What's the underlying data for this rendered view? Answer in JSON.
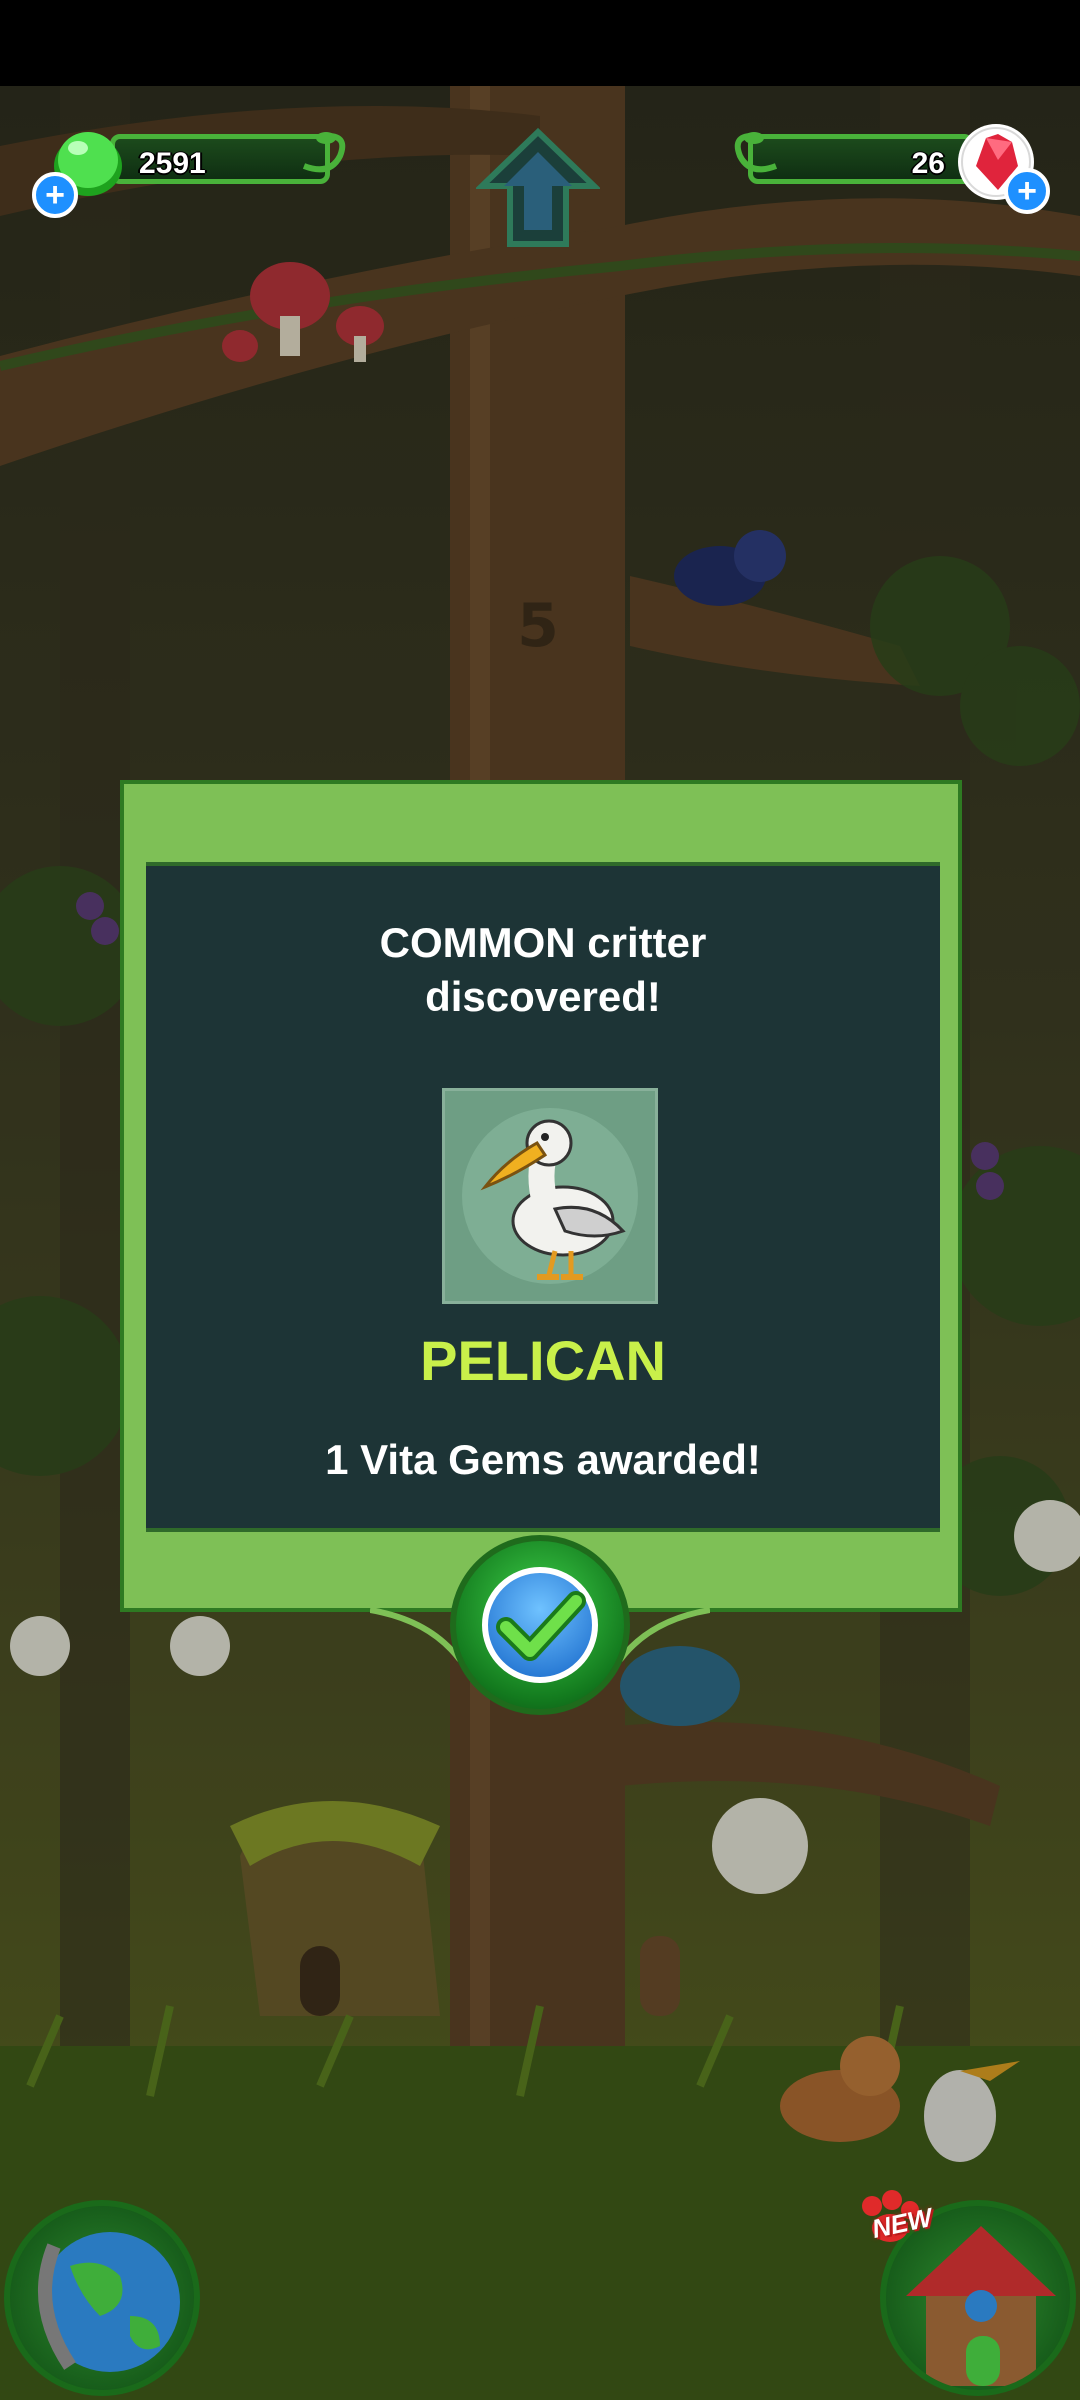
{
  "hud": {
    "vita_gel_count": "2591",
    "vita_gem_count": "26"
  },
  "tree": {
    "level_marker": "5"
  },
  "dialog": {
    "title_line1": "COMMON critter",
    "title_line2": "discovered!",
    "critter_name": "PELICAN",
    "award_text": "1 Vita Gems awarded!"
  },
  "bottom": {
    "new_badge": "NEW"
  },
  "colors": {
    "accent_green": "#7ec056",
    "dialog_bg": "#1d3436",
    "critter_name": "#c9f04a",
    "confirm_blue": "#1566c9"
  },
  "icons": [
    "vita-gel-icon",
    "vita-gem-icon",
    "plus-icon",
    "home-arrow-icon",
    "checkmark-icon",
    "globe-icon",
    "treehouse-icon"
  ]
}
